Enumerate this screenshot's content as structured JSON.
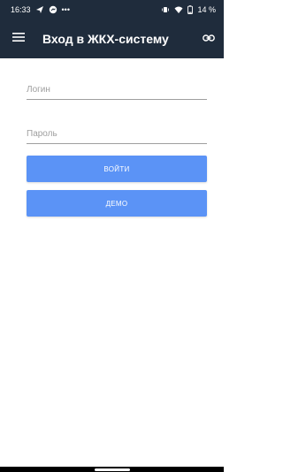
{
  "status_bar": {
    "time": "16:33",
    "dots": "•••",
    "battery": "14 %"
  },
  "app_bar": {
    "title": "Вход в ЖКХ-систему"
  },
  "form": {
    "login_placeholder": "Логин",
    "login_value": "",
    "password_placeholder": "Пароль",
    "password_value": ""
  },
  "buttons": {
    "login_label": "ВОЙТИ",
    "demo_label": "ДЕМО"
  },
  "colors": {
    "app_bar": "#1f2c3c",
    "button": "#5b93f6"
  },
  "icons": [
    "menu-icon",
    "link-icon",
    "send-icon",
    "messenger-icon",
    "wifi-icon",
    "battery-icon",
    "vibrate-icon"
  ]
}
